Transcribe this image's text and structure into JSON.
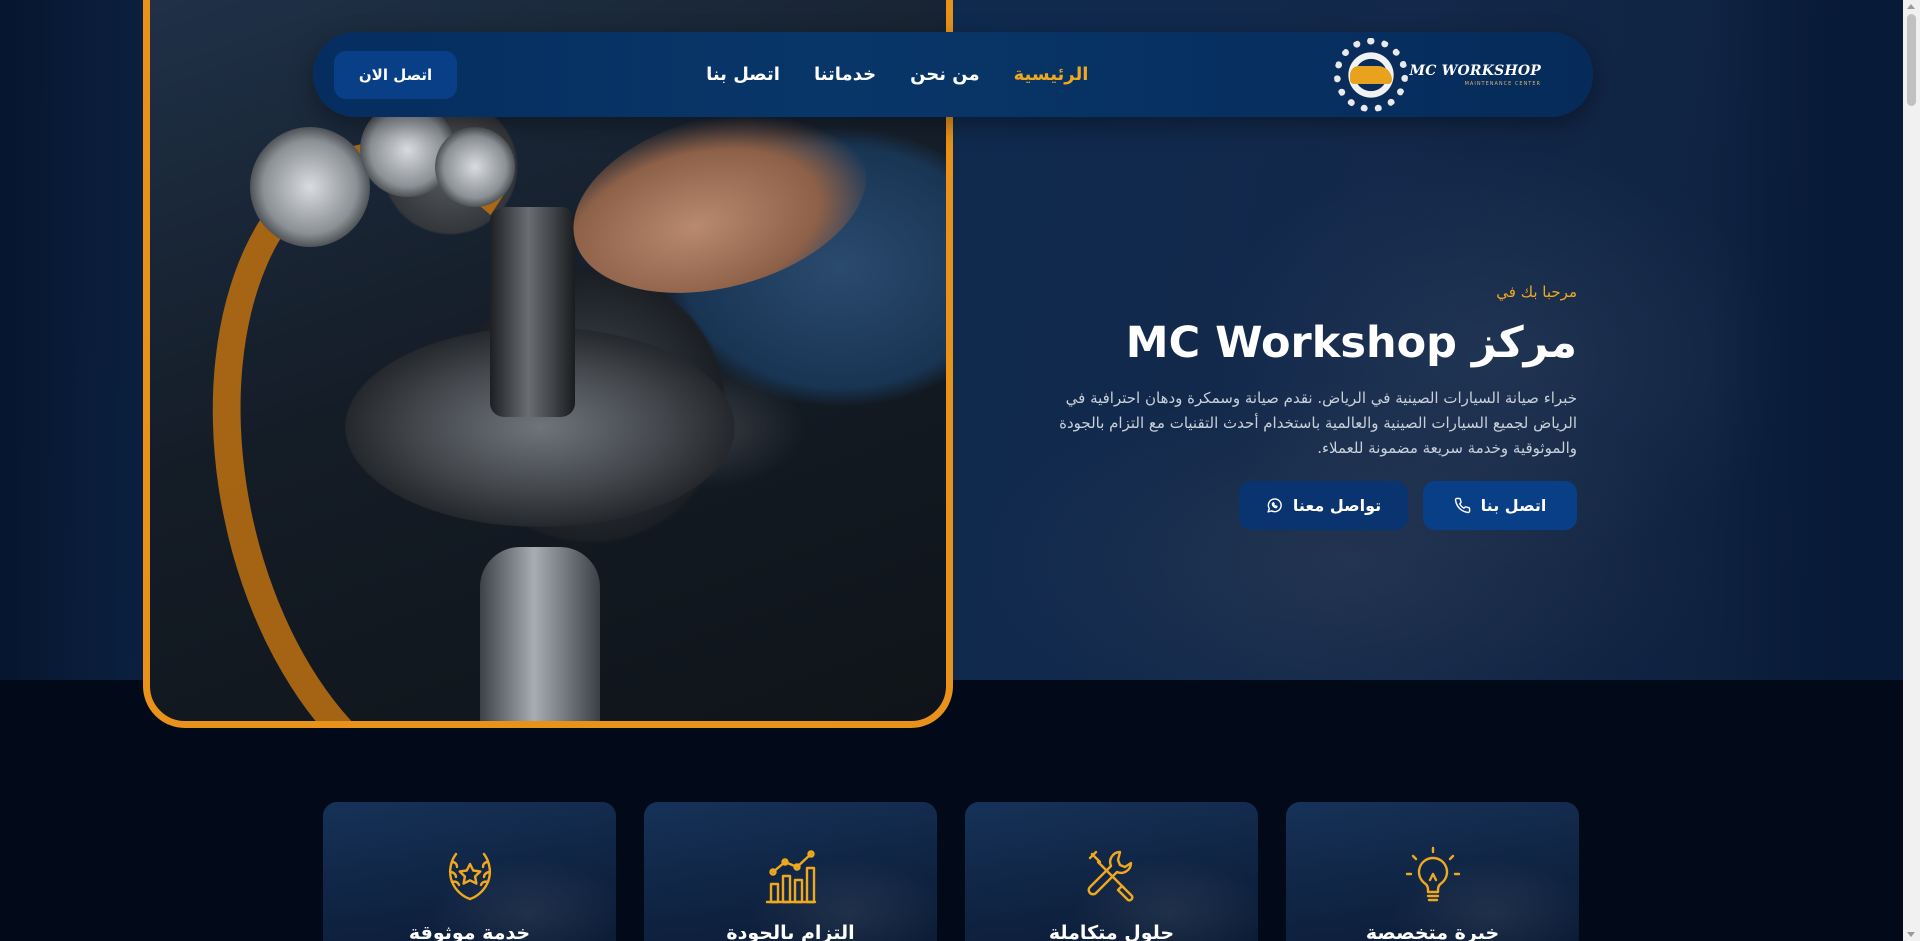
{
  "logo": {
    "title": "MC WORKSHOP",
    "subtitle": "MAINTENANCE CENTER"
  },
  "nav": {
    "items": [
      {
        "label": "الرئيسية",
        "active": true
      },
      {
        "label": "من نحن",
        "active": false
      },
      {
        "label": "خدماتنا",
        "active": false
      },
      {
        "label": "اتصل بنا",
        "active": false
      }
    ],
    "cta_label": "اتصل الان"
  },
  "hero": {
    "kicker": "مرحبا بك في",
    "title": "مركز MC Workshop",
    "description": "خبراء صيانة السيارات الصينية في الرياض. نقدم صيانة وسمكرة ودهان احترافية في الرياض لجميع السيارات الصينية والعالمية باستخدام أحدث التقنيات مع التزام بالجودة والموثوقية وخدمة سريعة مضمونة للعملاء.",
    "buttons": {
      "call": {
        "label": "اتصل بنا",
        "icon": "phone-icon"
      },
      "whatsapp": {
        "label": "تواصل معنا",
        "icon": "whatsapp-icon"
      }
    }
  },
  "features": [
    {
      "title": "خدمة موثوقة",
      "icon": "laurel-star-icon"
    },
    {
      "title": "التزام بالجودة",
      "icon": "bar-chart-icon"
    },
    {
      "title": "حلول متكاملة",
      "icon": "tools-icon"
    },
    {
      "title": "خبرة متخصصة",
      "icon": "lightbulb-icon"
    }
  ],
  "colors": {
    "accent": "#f0a91f",
    "frame": "#e8921c",
    "navbar": "#062d5f",
    "button": "#083f86",
    "background": "#020a1a"
  }
}
